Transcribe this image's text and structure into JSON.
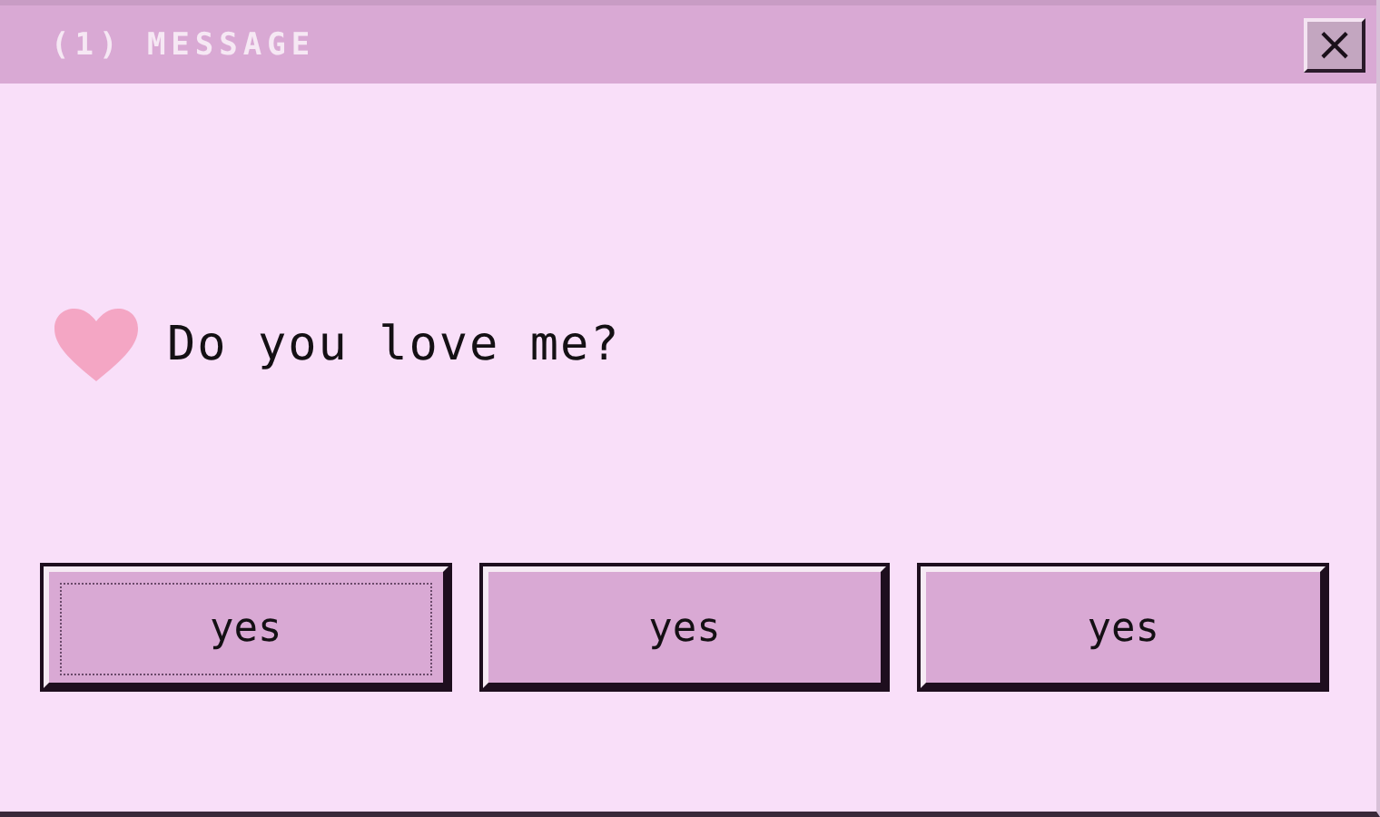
{
  "window": {
    "title": "(1) MESSAGE",
    "close": "×"
  },
  "message": "Do you love me?",
  "buttons": [
    {
      "label": "yes",
      "focused": true
    },
    {
      "label": "yes",
      "focused": false
    },
    {
      "label": "yes",
      "focused": false
    }
  ]
}
